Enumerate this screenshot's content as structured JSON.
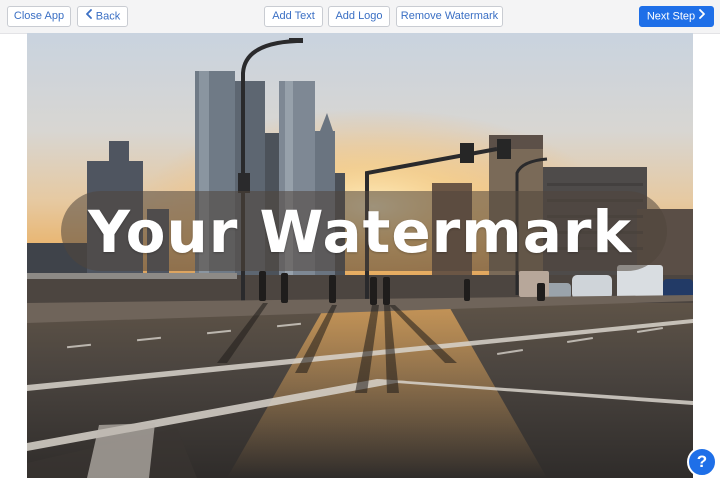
{
  "toolbar": {
    "close_label": "Close App",
    "back_label": "Back",
    "add_text_label": "Add Text",
    "add_logo_label": "Add Logo",
    "remove_watermark_label": "Remove Watermark",
    "next_step_label": "Next Step"
  },
  "canvas": {
    "watermark_text": "Your Watermark"
  },
  "help": {
    "label": "?"
  },
  "colors": {
    "accent": "#1e6fe8",
    "button_text": "#3a6fc4",
    "toolbar_bg": "#f4f4f5"
  },
  "icons": {
    "back": "chevron-left-icon",
    "next": "chevron-right-icon",
    "help": "question-icon"
  }
}
